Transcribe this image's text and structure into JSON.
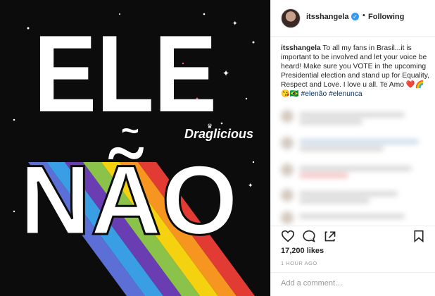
{
  "image": {
    "line1": "ELE",
    "tilde": "~",
    "line2": "NÃO",
    "watermark": "Draglicious",
    "stripe_colors": [
      "#5b6fd6",
      "#3a9ee4",
      "#6a3db3",
      "#8bc34a",
      "#f4d20f",
      "#f79521",
      "#e23b33"
    ]
  },
  "header": {
    "username": "itsshangela",
    "verified_icon": "verified-badge-icon",
    "separator": "•",
    "follow_state": "Following"
  },
  "caption": {
    "username": "itsshangela",
    "text": "To all my fans in Brasil...it is important to be involved and let your voice be heard! Make sure you VOTE in the upcoming Presidential election and stand up for Equality, Respect and Love. I love u all. Te Amo",
    "emojis": "❤️🌈😘🇧🇷",
    "hashtag1": "#elenão",
    "hashtag2": "#elenunca"
  },
  "actions": {
    "like_icon": "heart-icon",
    "comment_icon": "comment-icon",
    "share_icon": "share-icon",
    "save_icon": "bookmark-icon"
  },
  "likes": "17,200 likes",
  "time": "1 HOUR AGO",
  "comment": {
    "placeholder": "Add a comment…"
  },
  "colors": {
    "verified": "#3897f0",
    "hashtag": "#003569",
    "text": "#262626",
    "muted": "#999999"
  }
}
